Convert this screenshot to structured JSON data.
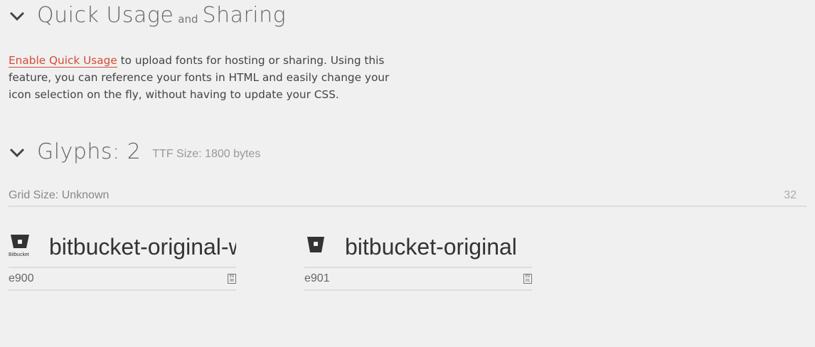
{
  "quick": {
    "title_a": "Quick Usage",
    "title_and": "and",
    "title_b": "Sharing",
    "link": "Enable Quick Usage",
    "text": " to upload fonts for hosting or sharing. Using this feature, you can reference your fonts in HTML and easily change your icon selection on the fly, without having to update your CSS."
  },
  "glyphs": {
    "title": "Glyphs: 2",
    "size": "TTF Size: 1800 bytes",
    "grid_label": "Grid Size: Unknown",
    "grid_value": "32",
    "items": [
      {
        "name": "bitbucket-original-wordmark",
        "code": "e900",
        "mini": "E9 00",
        "icon": "bitbucket-wordmark-icon",
        "icon_caption": "Bitbucket"
      },
      {
        "name": "bitbucket-original",
        "code": "e901",
        "mini": "E9 01",
        "icon": "bitbucket-icon"
      }
    ]
  },
  "colors": {
    "accent": "#d54a36",
    "background": "#f0f0f0"
  }
}
